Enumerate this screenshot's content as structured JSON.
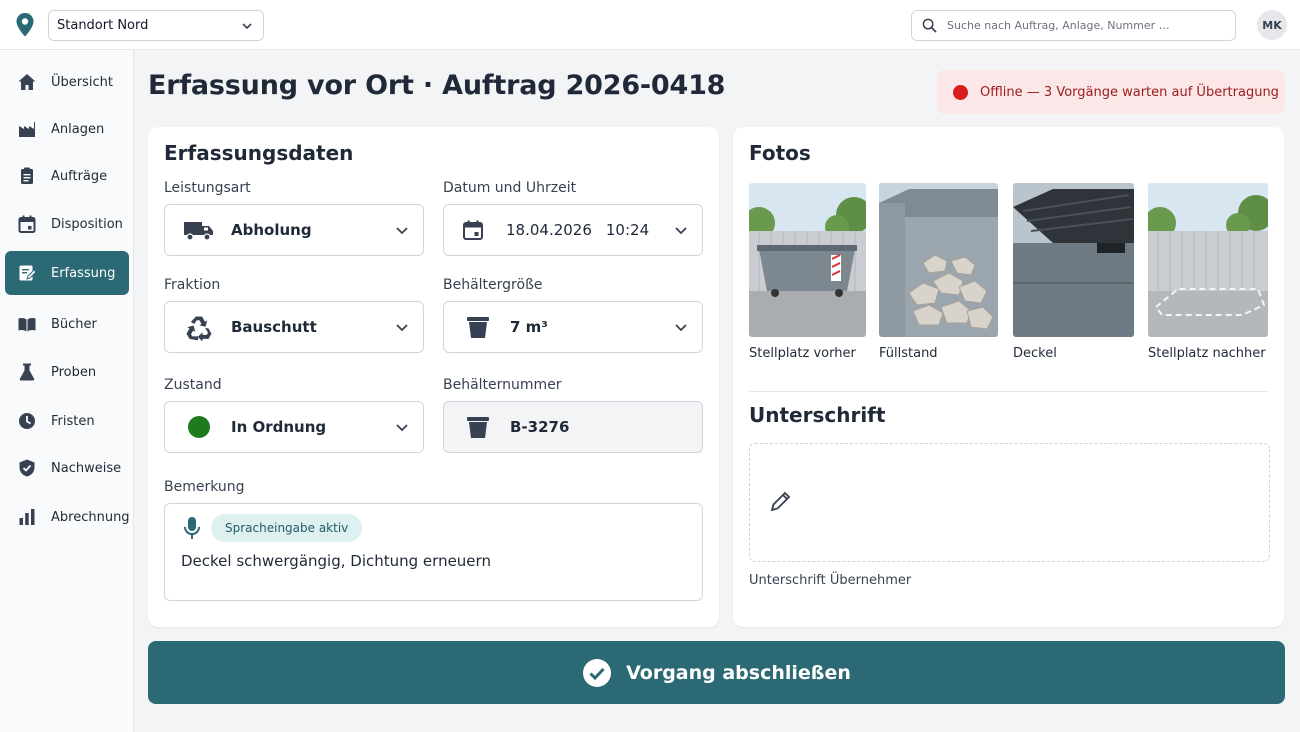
{
  "topbar": {
    "site_selected": "Standort Nord",
    "search_placeholder": "Suche nach Auftrag, Anlage, Nummer …",
    "user_initials": "MK"
  },
  "sidebar": {
    "active_index": 4,
    "items": [
      {
        "label": "Übersicht",
        "icon": "home-icon"
      },
      {
        "label": "Anlagen",
        "icon": "factory-icon"
      },
      {
        "label": "Aufträge",
        "icon": "clipboard-icon"
      },
      {
        "label": "Disposition",
        "icon": "calendar-icon"
      },
      {
        "label": "Erfassung",
        "icon": "edit-note-icon"
      },
      {
        "label": "Bücher",
        "icon": "book-icon"
      },
      {
        "label": "Proben",
        "icon": "flask-icon"
      },
      {
        "label": "Fristen",
        "icon": "clock-icon"
      },
      {
        "label": "Nachweise",
        "icon": "shield-check-icon"
      },
      {
        "label": "Abrechnung",
        "icon": "bar-chart-icon"
      }
    ]
  },
  "header": {
    "title": "Erfassung vor Ort · Auftrag 2026-0418",
    "offline_text": "Offline — 3 Vorgänge warten auf Übertragung"
  },
  "form": {
    "title": "Erfassungsdaten",
    "leistungsart": {
      "label": "Leistungsart",
      "value": "Abholung",
      "icon": "truck-icon"
    },
    "datum": {
      "label": "Datum und Uhrzeit",
      "date": "18.04.2026",
      "time": "10:24",
      "icon": "calendar-icon"
    },
    "fraktion": {
      "label": "Fraktion",
      "value": "Bauschutt",
      "icon": "recycle-icon"
    },
    "groesse": {
      "label": "Behältergröße",
      "value": "7 m³",
      "icon": "bin-icon"
    },
    "zustand": {
      "label": "Zustand",
      "value": "In Ordnung",
      "status_color": "#1f7a1f"
    },
    "nummer": {
      "label": "Behälternummer",
      "value": "B-3276",
      "icon": "bin-icon"
    },
    "bemerkung": {
      "label": "Bemerkung",
      "voice_chip": "Spracheingabe aktiv",
      "text": "Deckel schwergängig, Dichtung erneuern"
    }
  },
  "photos": {
    "title": "Fotos",
    "items": [
      {
        "caption": "Stellplatz vorher"
      },
      {
        "caption": "Füllstand"
      },
      {
        "caption": "Deckel"
      },
      {
        "caption": "Stellplatz nachher"
      }
    ]
  },
  "signature": {
    "title": "Unterschrift",
    "caption": "Unterschrift Übernehmer"
  },
  "actions": {
    "finish_label": "Vorgang abschließen"
  },
  "colors": {
    "accent": "#2b6a74",
    "offline_bg": "#fbe7e7",
    "offline_dot": "#d91c1c",
    "status_ok": "#1f7a1f"
  }
}
